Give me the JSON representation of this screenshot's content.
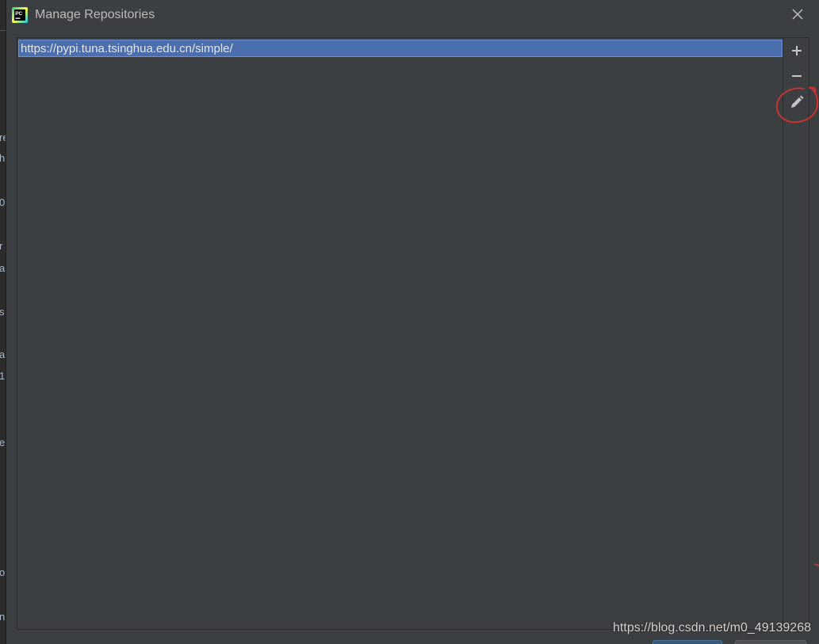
{
  "dialog": {
    "title": "Manage Repositories",
    "app_icon": "pycharm-logo-icon",
    "close_icon": "close-icon"
  },
  "repositories": [
    {
      "url": "https://pypi.tuna.tsinghua.edu.cn/simple/",
      "selected": true
    }
  ],
  "toolbar": {
    "add_icon": "plus-icon",
    "remove_icon": "minus-icon",
    "edit_icon": "pencil-icon"
  },
  "background_window": {
    "fragments": [
      "re",
      "h",
      "0",
      "r",
      "a",
      "s",
      "a",
      "1",
      "e",
      "o",
      "n"
    ]
  },
  "watermark": "https://blog.csdn.net/m0_49139268",
  "colors": {
    "dialog_bg": "#3c3f41",
    "selection_bg": "#4b6eaf",
    "text": "#bbbbbb",
    "annotation_red": "#d9312b"
  }
}
